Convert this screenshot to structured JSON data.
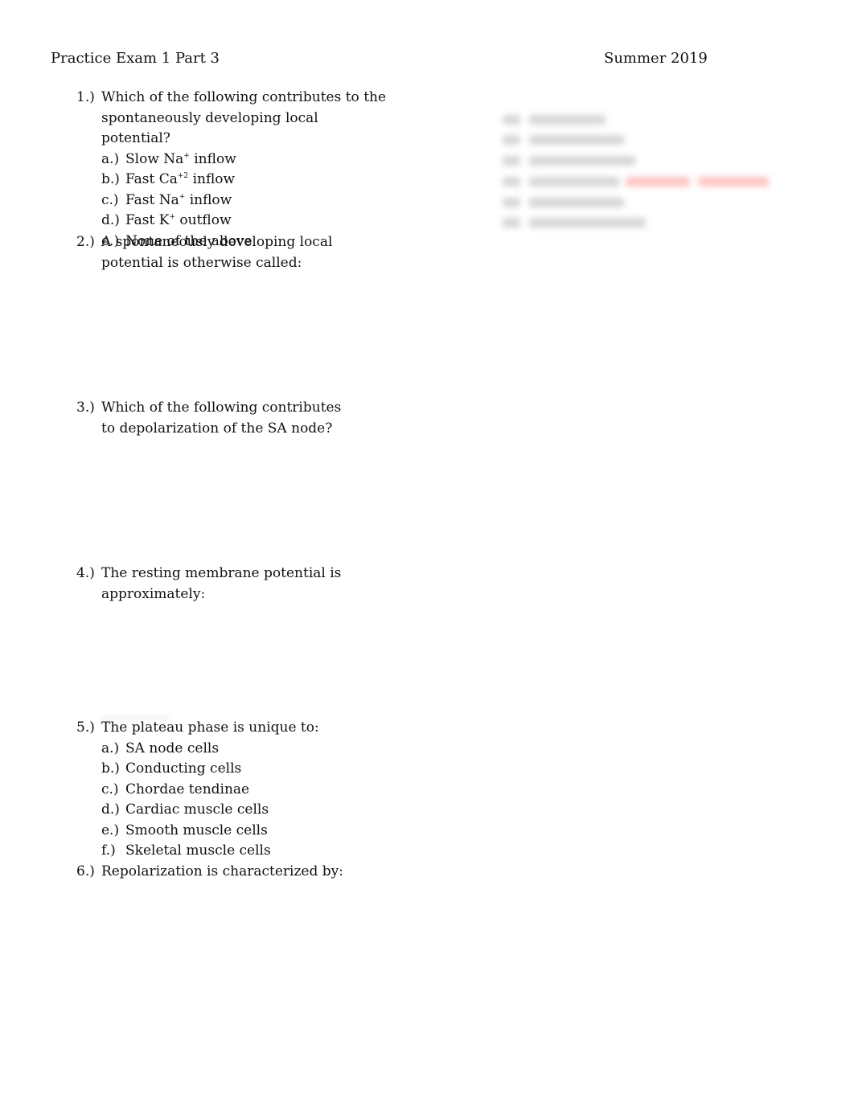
{
  "header": {
    "title": "Practice Exam 1 Part 3",
    "term": "Summer 2019"
  },
  "questions": [
    {
      "number": "1.)",
      "text": "Which of the following contributes to the spontaneously developing local potential?",
      "options": [
        {
          "label": "a.)",
          "pre": "Slow Na",
          "sup": "+",
          "post": " inflow"
        },
        {
          "label": "b.)",
          "pre": "Fast Ca",
          "sup": "+2",
          "post": " inflow"
        },
        {
          "label": "c.)",
          "pre": "Fast Na",
          "sup": "+",
          "post": " inflow"
        },
        {
          "label": "d.)",
          "pre": "Fast K",
          "sup": "+",
          "post": " outflow"
        },
        {
          "label": "e.)",
          "pre": "None of the above",
          "sup": "",
          "post": ""
        }
      ]
    },
    {
      "number": "2.)",
      "text": "A spontaneously developing local potential is otherwise called:"
    },
    {
      "number": "3.)",
      "text": "Which of the following contributes to depolarization of the SA node?"
    },
    {
      "number": "4.)",
      "text": "The resting membrane potential is approximately:"
    },
    {
      "number": "5.)",
      "text": "The plateau phase is unique to:",
      "options": [
        {
          "label": "a.)",
          "pre": "SA node cells"
        },
        {
          "label": "b.)",
          "pre": "Conducting cells"
        },
        {
          "label": "c.)",
          "pre": "Chordae tendinae"
        },
        {
          "label": "d.)",
          "pre": "Cardiac muscle cells"
        },
        {
          "label": "e.)",
          "pre": "Smooth muscle cells"
        },
        {
          "label": "f.)",
          "pre": "Skeletal muscle cells"
        }
      ]
    },
    {
      "number": "6.)",
      "text": "Repolarization is characterized by:"
    }
  ],
  "blurred_answers": {
    "note": "obscured content",
    "highlight_color": "#ff9a9a"
  }
}
